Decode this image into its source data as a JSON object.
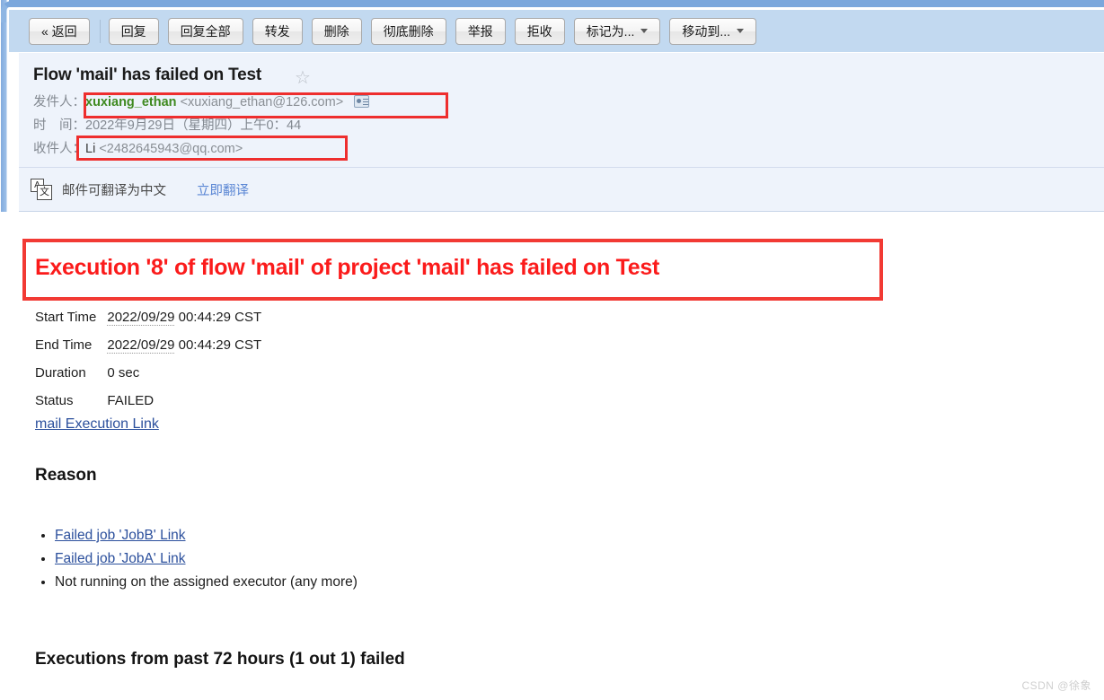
{
  "toolbar": {
    "buttons": [
      {
        "label": "« 返回",
        "name": "back-button",
        "caret": false
      },
      {
        "label": "回复",
        "name": "reply-button",
        "caret": false
      },
      {
        "label": "回复全部",
        "name": "reply-all-button",
        "caret": false
      },
      {
        "label": "转发",
        "name": "forward-button",
        "caret": false
      },
      {
        "label": "删除",
        "name": "delete-button",
        "caret": false
      },
      {
        "label": "彻底删除",
        "name": "delete-permanently-button",
        "caret": false
      },
      {
        "label": "举报",
        "name": "report-button",
        "caret": false
      },
      {
        "label": "拒收",
        "name": "reject-button",
        "caret": false
      },
      {
        "label": "标记为...",
        "name": "mark-as-dropdown",
        "caret": true
      },
      {
        "label": "移动到...",
        "name": "move-to-dropdown",
        "caret": true
      }
    ]
  },
  "mail_header": {
    "subject": "Flow 'mail' has failed on Test",
    "star_glyph": "☆",
    "from_label": "发件人：",
    "from_name": "xuxiang_ethan",
    "from_address": "<xuxiang_ethan@126.com>",
    "time_label": "时　间：",
    "time_value": "2022年9月29日（星期四）上午0：44",
    "to_label": "收件人：",
    "to_name": "Li",
    "to_address": "<2482645943@qq.com>"
  },
  "translate_bar": {
    "icon_back_char": "A",
    "icon_front_char": "文",
    "text": "邮件可翻译为中文",
    "link": "立即翻译"
  },
  "body": {
    "failure_title": "Execution '8' of flow 'mail' of project 'mail' has failed on Test",
    "details": [
      {
        "key": "Start Time",
        "date": "2022/09/29",
        "rest": "00:44:29 CST"
      },
      {
        "key": "End Time",
        "date": "2022/09/29",
        "rest": "00:44:29 CST"
      },
      {
        "key": "Duration",
        "date": "",
        "rest": "0 sec"
      },
      {
        "key": "Status",
        "date": "",
        "rest": "FAILED"
      }
    ],
    "execution_link": "mail Execution Link",
    "reason_heading": "Reason",
    "reason_items": [
      {
        "text": "Failed job 'JobB' Link",
        "link": true
      },
      {
        "text": "Failed job 'JobA' Link",
        "link": true
      },
      {
        "text": "Not running on the assigned executor (any more)",
        "link": false
      }
    ],
    "past_executions_heading": "Executions from past 72 hours (1 out 1) failed"
  },
  "watermark": "CSDN @徐象",
  "colors": {
    "toolbar_bg": "#c2d9f0",
    "header_bg": "#eef3fb",
    "annotation_red": "#ee2e2e",
    "failure_red": "#fb1b1b",
    "sender_green": "#3f8a20",
    "link_blue": "#2b4f9c",
    "translate_link_blue": "#5a86d4"
  }
}
